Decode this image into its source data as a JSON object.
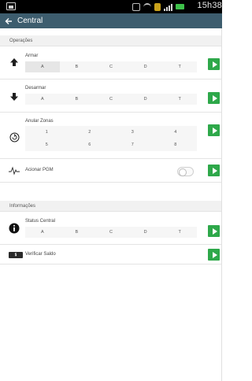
{
  "status_bar": {
    "time": "15h38"
  },
  "app_bar": {
    "title": "Central",
    "back_icon": "arrow-left-icon"
  },
  "operacoes": {
    "header": "Operações",
    "armar": {
      "label": "Armar",
      "icon": "arrow-up-icon",
      "options": [
        "A",
        "B",
        "C",
        "D",
        "T"
      ],
      "selected": "A"
    },
    "desarmar": {
      "label": "Desarmar",
      "icon": "arrow-down-icon",
      "options": [
        "A",
        "B",
        "C",
        "D",
        "T"
      ]
    },
    "anular_zonas": {
      "label": "Anular Zonas",
      "icon": "refresh-circle-icon",
      "zones": [
        "1",
        "2",
        "3",
        "4",
        "5",
        "6",
        "7",
        "8"
      ]
    },
    "acionar_pgm": {
      "label": "Acionar PGM",
      "icon": "signal-wave-icon",
      "toggle_on": false
    }
  },
  "informacoes": {
    "header": "Informações",
    "status_central": {
      "label": "Status Central",
      "icon": "info-circle-icon",
      "options": [
        "A",
        "B",
        "C",
        "D",
        "T"
      ]
    },
    "verificar_saldo": {
      "label": "Verificar Saldo",
      "icon": "money-icon",
      "icon_text": "$"
    }
  },
  "colors": {
    "app_bar": "#3d5d6e",
    "play_button": "#2ea84a",
    "status_bar": "#000000"
  }
}
